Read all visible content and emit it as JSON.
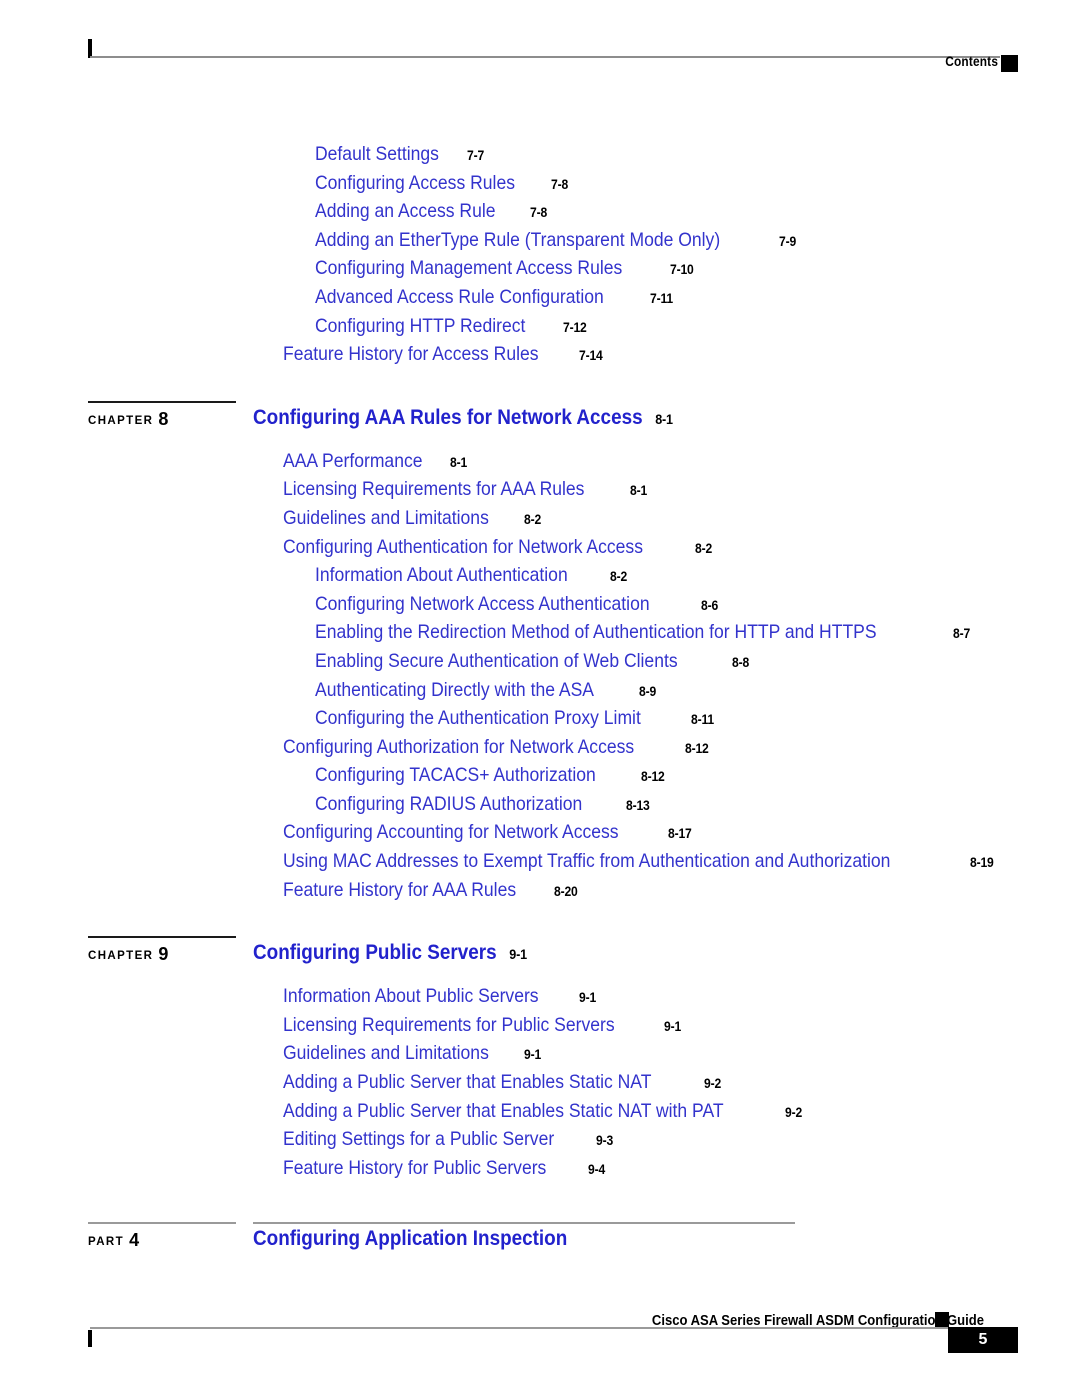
{
  "header": {
    "label": "Contents",
    "marker": "black-square"
  },
  "footer": {
    "guide_title": "Cisco ASA Series Firewall ASDM Configuration Guide",
    "page_number": "5",
    "marker": "black-square"
  },
  "toc": {
    "leading_entries": [
      {
        "level": 2,
        "title": "Default Settings",
        "page": "7-7"
      },
      {
        "level": 2,
        "title": "Configuring Access Rules",
        "page": "7-8"
      },
      {
        "level": 2,
        "title": "Adding an Access Rule",
        "page": "7-8"
      },
      {
        "level": 2,
        "title": "Adding an EtherType Rule (Transparent Mode Only)",
        "page": "7-9"
      },
      {
        "level": 2,
        "title": "Configuring Management Access Rules",
        "page": "7-10"
      },
      {
        "level": 2,
        "title": "Advanced Access Rule Configuration",
        "page": "7-11"
      },
      {
        "level": 2,
        "title": "Configuring HTTP Redirect",
        "page": "7-12"
      },
      {
        "level": 1,
        "title": "Feature History for Access Rules",
        "page": "7-14"
      }
    ],
    "blocks": [
      {
        "kind": "chapter",
        "kicker": "CHAPTER",
        "number": "8",
        "title": "Configuring AAA Rules for Network Access",
        "page": "8-1",
        "entries": [
          {
            "level": 1,
            "title": "AAA Performance",
            "page": "8-1"
          },
          {
            "level": 1,
            "title": "Licensing Requirements for AAA Rules",
            "page": "8-1"
          },
          {
            "level": 1,
            "title": "Guidelines and Limitations",
            "page": "8-2"
          },
          {
            "level": 1,
            "title": "Configuring Authentication for Network Access",
            "page": "8-2"
          },
          {
            "level": 2,
            "title": "Information About Authentication",
            "page": "8-2"
          },
          {
            "level": 2,
            "title": "Configuring Network Access Authentication",
            "page": "8-6"
          },
          {
            "level": 2,
            "title": "Enabling the Redirection Method of Authentication for HTTP and HTTPS",
            "page": "8-7"
          },
          {
            "level": 2,
            "title": "Enabling Secure Authentication of Web Clients",
            "page": "8-8"
          },
          {
            "level": 2,
            "title": "Authenticating Directly with the ASA",
            "page": "8-9"
          },
          {
            "level": 2,
            "title": "Configuring the Authentication Proxy Limit",
            "page": "8-11"
          },
          {
            "level": 1,
            "title": "Configuring Authorization for Network Access",
            "page": "8-12"
          },
          {
            "level": 2,
            "title": "Configuring TACACS+ Authorization",
            "page": "8-12"
          },
          {
            "level": 2,
            "title": "Configuring RADIUS Authorization",
            "page": "8-13"
          },
          {
            "level": 1,
            "title": "Configuring Accounting for Network Access",
            "page": "8-17"
          },
          {
            "level": 1,
            "title": "Using MAC Addresses to Exempt Traffic from Authentication and Authorization",
            "page": "8-19"
          },
          {
            "level": 1,
            "title": "Feature History for AAA Rules",
            "page": "8-20"
          }
        ]
      },
      {
        "kind": "chapter",
        "kicker": "CHAPTER",
        "number": "9",
        "title": "Configuring Public Servers",
        "page": "9-1",
        "entries": [
          {
            "level": 1,
            "title": "Information About Public Servers",
            "page": "9-1"
          },
          {
            "level": 1,
            "title": "Licensing Requirements for Public Servers",
            "page": "9-1"
          },
          {
            "level": 1,
            "title": "Guidelines and Limitations",
            "page": "9-1"
          },
          {
            "level": 1,
            "title": "Adding a Public Server that Enables Static NAT",
            "page": "9-2"
          },
          {
            "level": 1,
            "title": "Adding a Public Server that Enables Static NAT with PAT",
            "page": "9-2"
          },
          {
            "level": 1,
            "title": "Editing Settings for a Public Server",
            "page": "9-3"
          },
          {
            "level": 1,
            "title": "Feature History for Public Servers",
            "page": "9-4"
          }
        ]
      },
      {
        "kind": "part",
        "kicker": "PART",
        "number": "4",
        "title": "Configuring Application Inspection",
        "page": "",
        "entries": []
      }
    ]
  },
  "colors": {
    "link_blue": "#3333cc",
    "heading_blue": "#2222cc",
    "rule_gray": "#9a9a9a",
    "text_black": "#000000"
  }
}
